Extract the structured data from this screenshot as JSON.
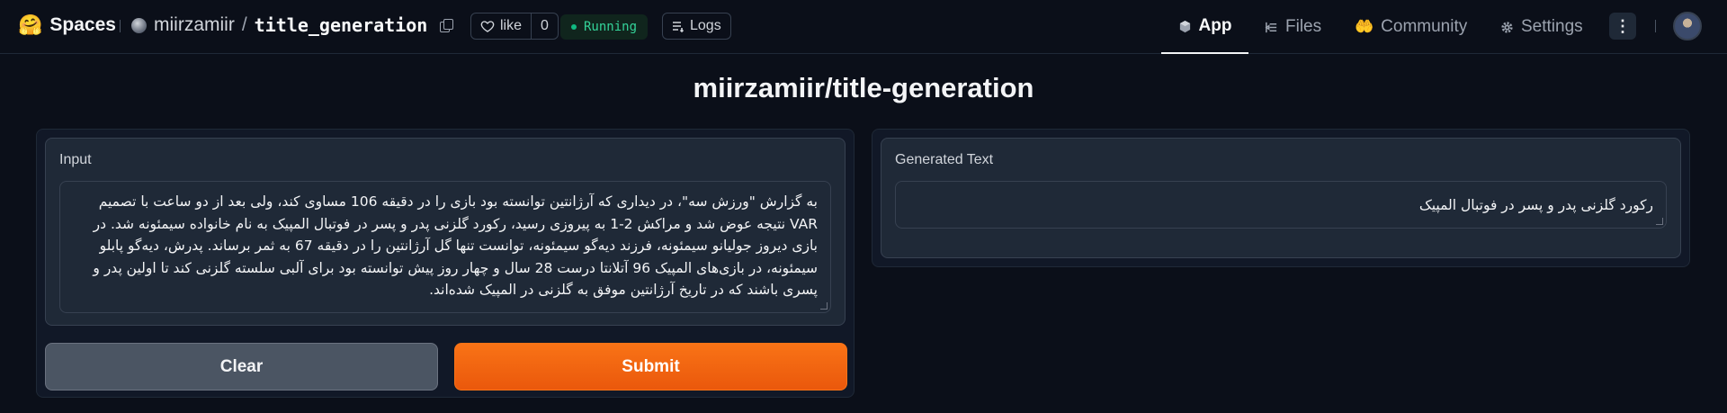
{
  "header": {
    "brand_emoji": "🤗",
    "brand": "Spaces",
    "repo_owner": "miirzamiir",
    "repo_slash": "/",
    "repo_name": "title_generation",
    "like_label": "like",
    "like_count": "0",
    "status": "Running",
    "logs_label": "Logs",
    "nav": {
      "app": "App",
      "files": "Files",
      "community": "Community",
      "settings": "Settings"
    },
    "more_label": "⋮"
  },
  "page": {
    "title": "miirzamiir/title-generation"
  },
  "input_panel": {
    "label": "Input",
    "text": "به گزارش \"ورزش سه\"، در دیداری که آرژانتین توانسته بود بازی را در دقیقه 106 مساوی کند، ولی بعد از دو ساعت با تصمیم VAR نتیجه عوض شد و مراکش 2-1 به پیروزی رسید، رکورد گلزنی پدر و پسر در فوتبال المپیک به نام خانواده سیمئونه شد. در بازی دیروز جولیانو سیمئونه، فرزند دیه‌گو سیمئونه، توانست تنها گل آرژانتین را در دقیقه 67 به ثمر برساند. پدرش، دیه‌گو پابلو سیمئونه، در بازی‌های المپیک 96 آتلانتا درست 28 سال و چهار روز پیش توانسته بود برای آلبی سلسته گلزنی کند تا اولین پدر و پسری باشند که در تاریخ آرژانتین موفق به گلزنی در المپیک شده‌اند."
  },
  "actions": {
    "clear": "Clear",
    "submit": "Submit"
  },
  "output_panel": {
    "label": "Generated Text",
    "text": "رکورد گلزنی پدر و پسر در فوتبال المپیک"
  },
  "colors": {
    "accent": "#f97316",
    "status_green": "#10b981",
    "background": "#0b0f19"
  }
}
